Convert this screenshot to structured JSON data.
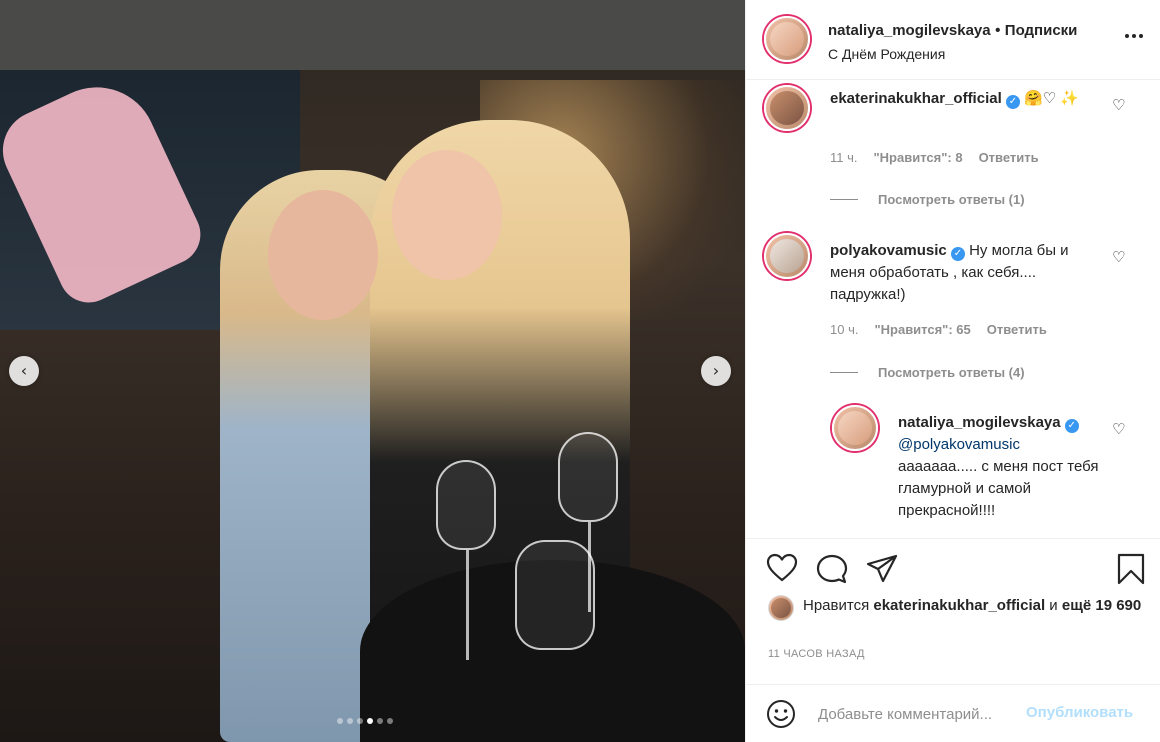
{
  "post": {
    "username": "nataliya_mogilevskaya",
    "follow_separator": "•",
    "follow_label": "Подписки",
    "location": "С Днём Рождения",
    "more_icon": "more-horizontal-icon"
  },
  "carousel": {
    "prev_icon": "chevron-left-icon",
    "next_icon": "chevron-right-icon",
    "dot_count": 6,
    "active_dot": 3
  },
  "comments": [
    {
      "username": "ekaterinakukhar_official",
      "verified": true,
      "text": "🤗♡ ✨",
      "time": "11 ч.",
      "likes": "\"Нравится\": 8",
      "reply_label": "Ответить",
      "view_replies": "Посмотреть ответы (1)"
    },
    {
      "username": "polyakovamusic",
      "verified": true,
      "text": "Ну могла бы и меня обработать , как себя.... падружка!)",
      "time": "10 ч.",
      "likes": "\"Нравится\": 65",
      "reply_label": "Ответить",
      "view_replies": "Посмотреть ответы (4)"
    }
  ],
  "reply": {
    "username": "nataliya_mogilevskaya",
    "verified": true,
    "mention": "@polyakovamusic",
    "text": "ааааааа..... с меня пост тебя гламурной и самой прекрасной!!!!"
  },
  "actions": {
    "like_icon": "heart-icon",
    "comment_icon": "comment-icon",
    "share_icon": "paper-plane-icon",
    "save_icon": "bookmark-icon"
  },
  "likes": {
    "prefix": "Нравится",
    "user": "ekaterinakukhar_official",
    "conjunction": "и",
    "others": "ещё 19 690"
  },
  "timestamp": "11 ЧАСОВ НАЗАД",
  "comment_box": {
    "emoji_icon": "smiley-icon",
    "placeholder": "Добавьте комментарий...",
    "publish_label": "Опубликовать"
  },
  "colors": {
    "verified": "#3897f0",
    "publish_disabled": "#b2dffc",
    "muted": "#8e8e8e",
    "text": "#262626"
  }
}
